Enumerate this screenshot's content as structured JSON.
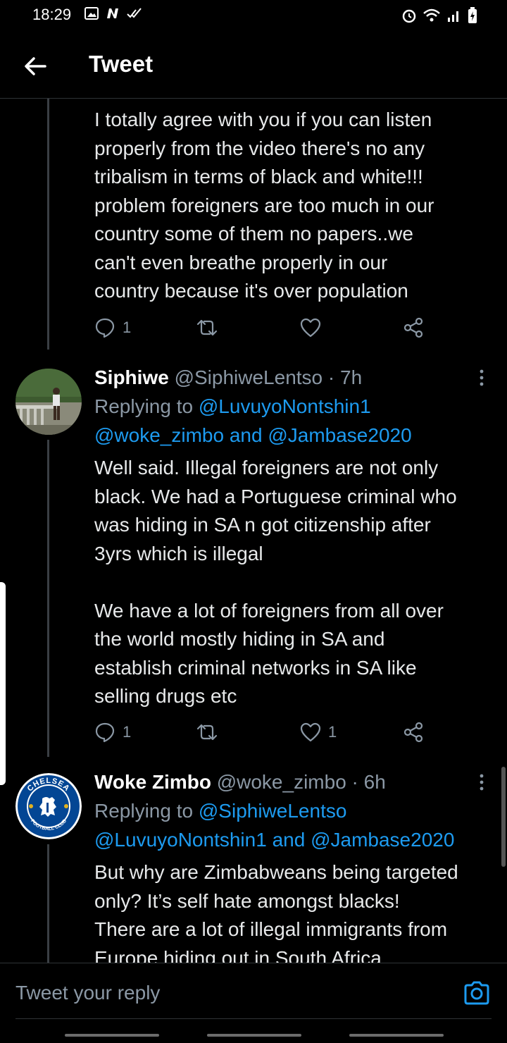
{
  "status_bar": {
    "time": "18:29",
    "left_icons": [
      "image-icon",
      "n-icon",
      "double-check-icon"
    ],
    "right_icons": [
      "alarm-icon",
      "wifi-icon",
      "signal-icon",
      "battery-charging-icon"
    ]
  },
  "header": {
    "title": "Tweet",
    "back_icon": "arrow-left-icon"
  },
  "tweets": [
    {
      "text_lines": [
        "I totally agree with you if you can listen",
        "properly from the video there's no any",
        "tribalism in terms of black and white!!!",
        "problem foreigners are too much in our",
        "country some of them no papers..we",
        "can't even breathe properly in our",
        "country because it's over population"
      ],
      "replies": "1",
      "retweets": "",
      "likes": ""
    },
    {
      "name": "Siphiwe",
      "handle": "@SiphiweLentso · 7h",
      "replying_prefix": "Replying to ",
      "replying_mention1": "@LuvuyoNontshin1",
      "replying_mention2": "@woke_zimbo",
      "replying_and": " and ",
      "replying_mention3": "@Jambase2020",
      "text_lines": [
        "Well said. Illegal foreigners are not only",
        "black. We had a Portuguese criminal who",
        "was hiding in SA n got citizenship after",
        "3yrs which is illegal",
        "",
        "We have a lot of foreigners from all over",
        "the world mostly hiding in SA and",
        "establish criminal networks in SA like",
        "selling drugs etc"
      ],
      "replies": "1",
      "retweets": "",
      "likes": "1"
    },
    {
      "name": "Woke Zimbo",
      "handle": "@woke_zimbo · 6h",
      "replying_prefix": "Replying to ",
      "replying_mention1": "@SiphiweLentso",
      "replying_mention2": "@LuvuyoNontshin1",
      "replying_and": " and ",
      "replying_mention3": "@Jambase2020",
      "text_lines": [
        "But why are Zimbabweans being targeted",
        "only? It’s self hate amongst blacks!",
        "There are a lot of illegal immigrants from",
        "Europe hiding out in South Africa"
      ],
      "avatar_text_top": "CHELSEA",
      "avatar_text_bottom": "FOOTBALL CLUB"
    }
  ],
  "reply_bar": {
    "placeholder": "Tweet your reply",
    "camera_icon": "camera-icon"
  },
  "colors": {
    "background": "#000000",
    "link": "#1d9bf0",
    "muted": "#8b98a5",
    "text": "#e7e9ea"
  }
}
